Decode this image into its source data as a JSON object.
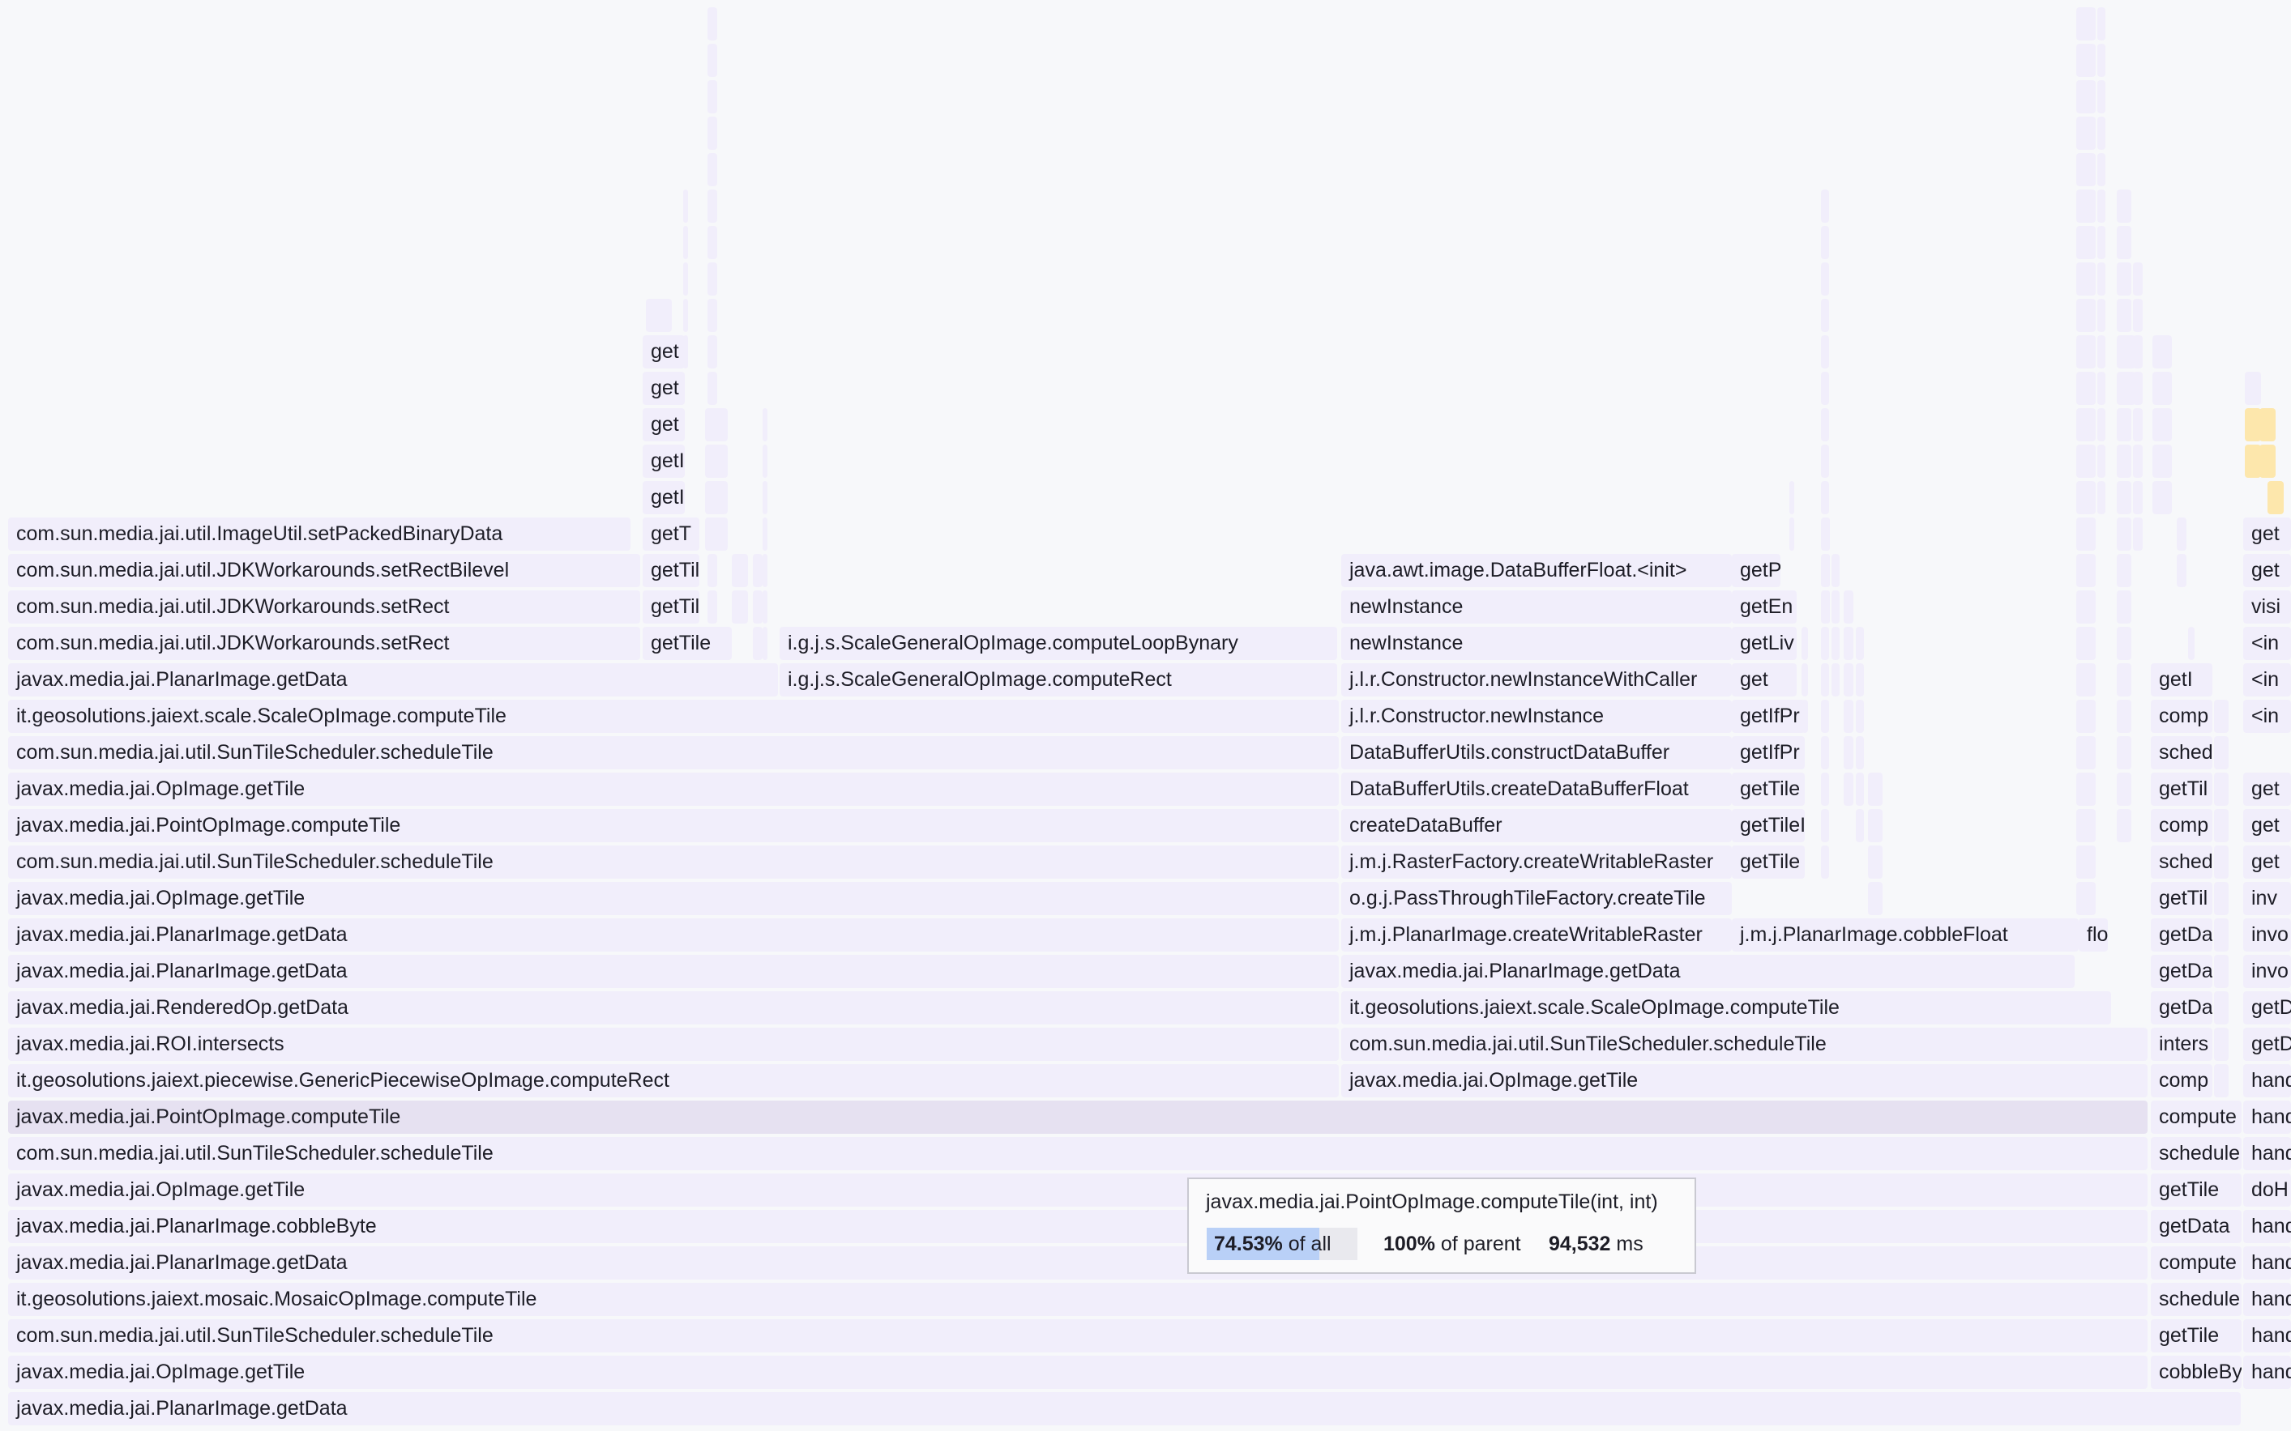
{
  "flame": {
    "frames": [
      {
        "label": "com.sun.media.jai.util.ImageUtil.setPackedBinaryData"
      },
      {
        "label": "com.sun.media.jai.util.JDKWorkarounds.setRectBilevel"
      },
      {
        "label": "com.sun.media.jai.util.JDKWorkarounds.setRect"
      },
      {
        "label": "com.sun.media.jai.util.JDKWorkarounds.setRect"
      },
      {
        "label": "javax.media.jai.PlanarImage.getData"
      },
      {
        "label": "it.geosolutions.jaiext.scale.ScaleOpImage.computeTile"
      },
      {
        "label": "com.sun.media.jai.util.SunTileScheduler.scheduleTile"
      },
      {
        "label": "javax.media.jai.OpImage.getTile"
      },
      {
        "label": "javax.media.jai.PointOpImage.computeTile"
      },
      {
        "label": "com.sun.media.jai.util.SunTileScheduler.scheduleTile"
      },
      {
        "label": "javax.media.jai.OpImage.getTile"
      },
      {
        "label": "javax.media.jai.PlanarImage.getData"
      },
      {
        "label": "javax.media.jai.PlanarImage.getData"
      },
      {
        "label": "javax.media.jai.RenderedOp.getData"
      },
      {
        "label": "javax.media.jai.ROI.intersects"
      },
      {
        "label": "it.geosolutions.jaiext.piecewise.GenericPiecewiseOpImage.computeRect"
      },
      {
        "label": "javax.media.jai.PointOpImage.computeTile"
      },
      {
        "label": "com.sun.media.jai.util.SunTileScheduler.scheduleTile"
      },
      {
        "label": "javax.media.jai.OpImage.getTile"
      },
      {
        "label": "javax.media.jai.PlanarImage.cobbleByte"
      },
      {
        "label": "javax.media.jai.PlanarImage.getData"
      },
      {
        "label": "it.geosolutions.jaiext.mosaic.MosaicOpImage.computeTile"
      },
      {
        "label": "com.sun.media.jai.util.SunTileScheduler.scheduleTile"
      },
      {
        "label": "javax.media.jai.OpImage.getTile"
      },
      {
        "label": "javax.media.jai.PlanarImage.getData"
      },
      {
        "label": "get"
      },
      {
        "label": "get"
      },
      {
        "label": "get"
      },
      {
        "label": "getIfP"
      },
      {
        "label": "getIfP"
      },
      {
        "label": "getT"
      },
      {
        "label": "getTil"
      },
      {
        "label": "getTil"
      },
      {
        "label": "getTile"
      },
      {
        "label": "i.g.j.s.ScaleGeneralOpImage.computeLoopBynary"
      },
      {
        "label": "i.g.j.s.ScaleGeneralOpImage.computeRect"
      },
      {
        "label": "java.awt.image.DataBufferFloat.<init>"
      },
      {
        "label": "newInstance"
      },
      {
        "label": "newInstance"
      },
      {
        "label": "j.l.r.Constructor.newInstanceWithCaller"
      },
      {
        "label": "j.l.r.Constructor.newInstance"
      },
      {
        "label": "DataBufferUtils.constructDataBuffer"
      },
      {
        "label": "DataBufferUtils.createDataBufferFloat"
      },
      {
        "label": "createDataBuffer"
      },
      {
        "label": "j.m.j.RasterFactory.createWritableRaster"
      },
      {
        "label": "o.g.j.PassThroughTileFactory.createTile"
      },
      {
        "label": "j.m.j.PlanarImage.createWritableRaster"
      },
      {
        "label": "javax.media.jai.PlanarImage.getData"
      },
      {
        "label": "it.geosolutions.jaiext.scale.ScaleOpImage.computeTile"
      },
      {
        "label": "com.sun.media.jai.util.SunTileScheduler.scheduleTile"
      },
      {
        "label": "javax.media.jai.OpImage.getTile"
      },
      {
        "label": "getP"
      },
      {
        "label": "getEn"
      },
      {
        "label": "getLiv"
      },
      {
        "label": "get"
      },
      {
        "label": "getIfPr"
      },
      {
        "label": "getIfPr"
      },
      {
        "label": "getTile"
      },
      {
        "label": "getTileI"
      },
      {
        "label": "getTile"
      },
      {
        "label": "j.m.j.PlanarImage.cobbleFloat"
      },
      {
        "label": "floa"
      },
      {
        "label": "getI"
      },
      {
        "label": "comp"
      },
      {
        "label": "sched"
      },
      {
        "label": "getTil"
      },
      {
        "label": "comp"
      },
      {
        "label": "sched"
      },
      {
        "label": "getTil"
      },
      {
        "label": "getDa"
      },
      {
        "label": "getDa"
      },
      {
        "label": "getDa"
      },
      {
        "label": "inters"
      },
      {
        "label": "comp"
      },
      {
        "label": "compute"
      },
      {
        "label": "schedule"
      },
      {
        "label": "getTile"
      },
      {
        "label": "getData"
      },
      {
        "label": "compute"
      },
      {
        "label": "schedule"
      },
      {
        "label": "getTile"
      },
      {
        "label": "cobbleBy"
      },
      {
        "label": "get"
      },
      {
        "label": "get"
      },
      {
        "label": "visi"
      },
      {
        "label": "<in"
      },
      {
        "label": "<in"
      },
      {
        "label": "<in"
      },
      {
        "label": "get"
      },
      {
        "label": "get"
      },
      {
        "label": "get"
      },
      {
        "label": "inv"
      },
      {
        "label": "invo"
      },
      {
        "label": "invo"
      },
      {
        "label": "getD"
      },
      {
        "label": "getD"
      },
      {
        "label": "hand"
      },
      {
        "label": "hand"
      },
      {
        "label": "hand"
      },
      {
        "label": "doH"
      },
      {
        "label": "hand"
      },
      {
        "label": "hand"
      },
      {
        "label": "hand"
      },
      {
        "label": "hand"
      },
      {
        "label": "hand"
      },
      {
        "label": "hand"
      }
    ]
  },
  "tooltip": {
    "title": "javax.media.jai.PointOpImage.computeTile(int, int)",
    "pct_all": "74.53%",
    "pct_all_fraction": 0.7453,
    "of_all": "of all",
    "pct_parent": "100%",
    "of_parent": "of parent",
    "time_value": "94,532",
    "time_unit": "ms"
  }
}
